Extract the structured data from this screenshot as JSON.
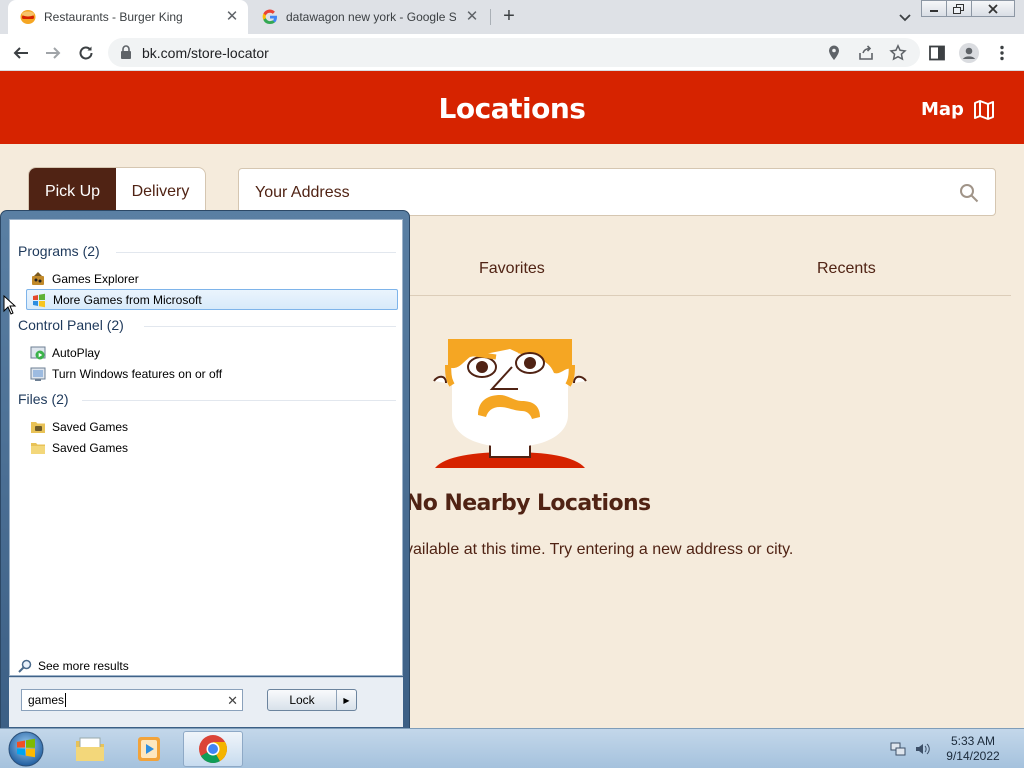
{
  "browser": {
    "tabs": [
      {
        "title": "Restaurants - Burger King",
        "favicon": "burger-king-icon"
      },
      {
        "title": "datawagon new york - Google Se",
        "favicon": "google-icon"
      }
    ],
    "url": "bk.com/store-locator"
  },
  "page": {
    "header_title": "Locations",
    "map_label": "Map",
    "modes": {
      "pickup": "Pick Up",
      "delivery": "Delivery"
    },
    "address_placeholder": "Your Address",
    "location_tabs": {
      "favorites": "Favorites",
      "recents": "Recents"
    },
    "empty_title": "No Nearby Locations",
    "empty_subtitle": "vailable at this time. Try entering a new address or city.",
    "colors": {
      "brand_red": "#d62300",
      "brand_brown": "#502314",
      "background": "#f5ebdc"
    }
  },
  "start_menu": {
    "groups": [
      {
        "label": "Programs (2)",
        "items": [
          "Games Explorer",
          "More Games from Microsoft"
        ]
      },
      {
        "label": "Control Panel (2)",
        "items": [
          "AutoPlay",
          "Turn Windows features on or off"
        ]
      },
      {
        "label": "Files (2)",
        "items": [
          "Saved Games",
          "Saved Games"
        ]
      }
    ],
    "see_more": "See more results",
    "search_value": "games",
    "lock_label": "Lock"
  },
  "taskbar": {
    "time": "5:33 AM",
    "date": "9/14/2022"
  }
}
